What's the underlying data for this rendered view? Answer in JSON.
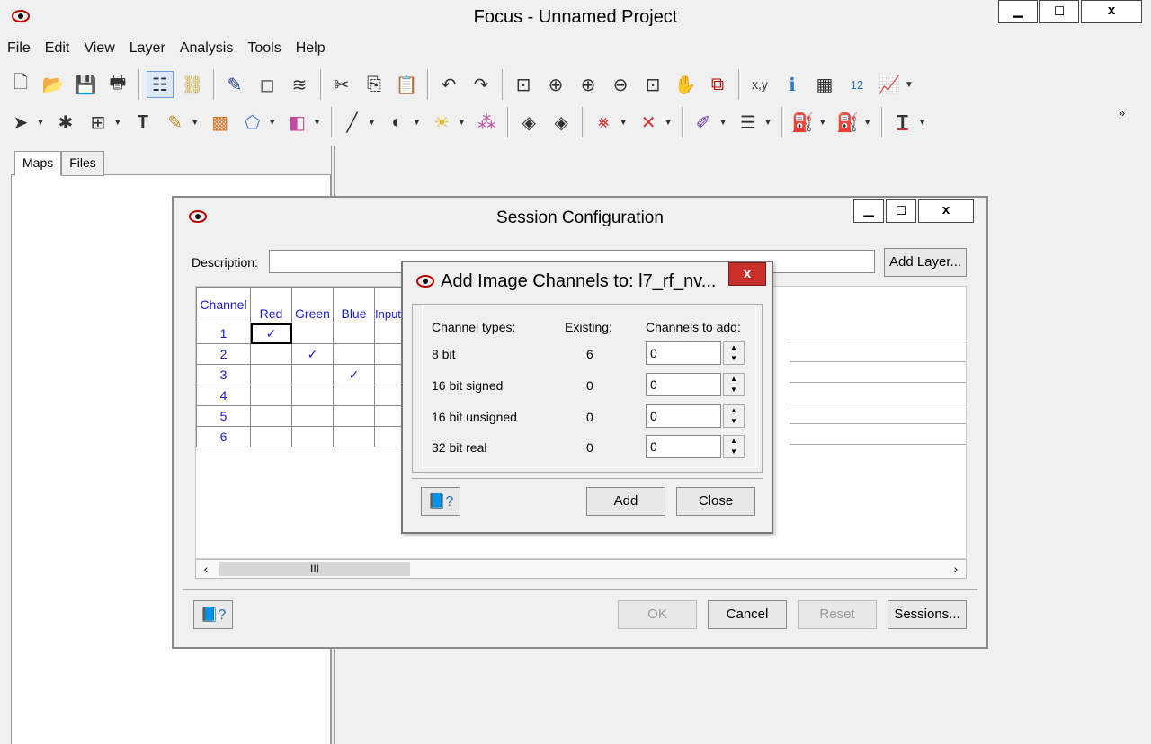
{
  "window": {
    "title": "Focus - Unnamed Project",
    "minimize": "▁",
    "maximize": "◻",
    "close": "x"
  },
  "menu": [
    "File",
    "Edit",
    "View",
    "Layer",
    "Analysis",
    "Tools",
    "Help"
  ],
  "left_panel": {
    "tabs": [
      "Maps",
      "Files"
    ]
  },
  "session_dialog": {
    "title": "Session Configuration",
    "description_label": "Description:",
    "description_value": "",
    "add_layer_label": "Add Layer...",
    "grid": {
      "headers": [
        "Channel",
        "Red",
        "Green",
        "Blue",
        "Input Channel"
      ],
      "rows": [
        {
          "channel": "1",
          "red": "✓",
          "green": "",
          "blue": ""
        },
        {
          "channel": "2",
          "red": "",
          "green": "✓",
          "blue": ""
        },
        {
          "channel": "3",
          "red": "",
          "green": "",
          "blue": "✓"
        },
        {
          "channel": "4",
          "red": "",
          "green": "",
          "blue": ""
        },
        {
          "channel": "5",
          "red": "",
          "green": "",
          "blue": ""
        },
        {
          "channel": "6",
          "red": "",
          "green": "",
          "blue": ""
        }
      ]
    },
    "scroll_thumb": "III",
    "ok_label": "OK",
    "cancel_label": "Cancel",
    "reset_label": "Reset",
    "sessions_label": "Sessions..."
  },
  "add_channels_dialog": {
    "title": "Add Image Channels to: l7_rf_nv...",
    "close": "x",
    "col_types": "Channel types:",
    "col_existing": "Existing:",
    "col_to_add": "Channels to add:",
    "rows": [
      {
        "type": "8 bit",
        "existing": "6",
        "to_add": "0"
      },
      {
        "type": "16 bit signed",
        "existing": "0",
        "to_add": "0"
      },
      {
        "type": "16 bit unsigned",
        "existing": "0",
        "to_add": "0"
      },
      {
        "type": "32 bit real",
        "existing": "0",
        "to_add": "0"
      }
    ],
    "add_label": "Add",
    "close_label": "Close"
  }
}
